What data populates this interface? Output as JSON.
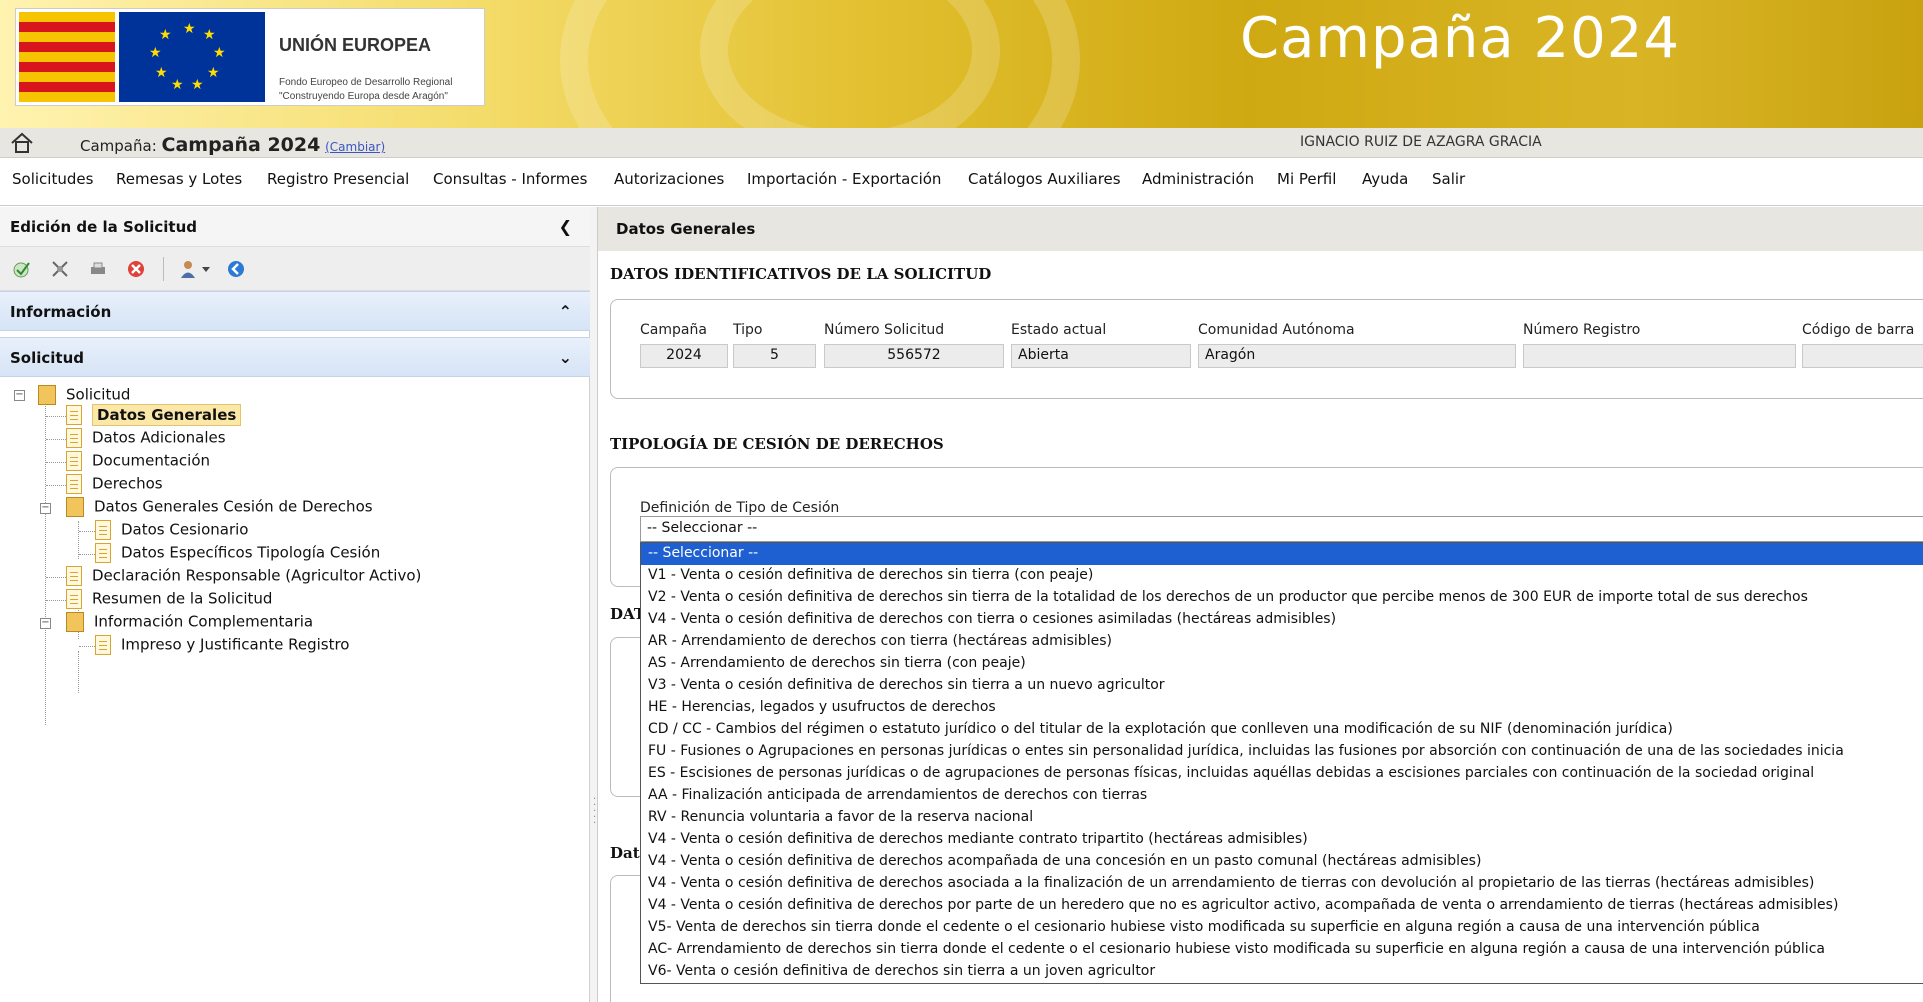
{
  "banner": {
    "eu_title": "UNIÓN EUROPEA",
    "eu_subtitle_1": "Fondo Europeo de Desarrollo Regional",
    "eu_subtitle_2": "\"Construyendo Europa desde Aragón\"",
    "title": "Campaña 2024"
  },
  "campaign_bar": {
    "label": "Campaña: ",
    "value": "Campaña 2024",
    "change_link": "(Cambiar)",
    "user": "IGNACIO RUIZ DE AZAGRA GRACIA"
  },
  "menu": {
    "items": [
      "Solicitudes",
      "Remesas y Lotes",
      "Registro Presencial",
      "Consultas - Informes",
      "Autorizaciones",
      "Importación - Exportación",
      "Catálogos Auxiliares",
      "Administración",
      "Mi Perfil",
      "Ayuda",
      "Salir"
    ]
  },
  "left_panel": {
    "header": "Edición de la Solicitud",
    "info_section": "Información",
    "solicitud_section": "Solicitud",
    "tree": {
      "root": "Solicitud",
      "items": [
        "Datos Generales",
        "Datos Adicionales",
        "Documentación",
        "Derechos",
        "Datos Generales Cesión de Derechos",
        "Datos Cesionario",
        "Datos Específicos Tipología Cesión",
        "Declaración Responsable (Agricultor Activo)",
        "Resumen de la Solicitud",
        "Información Complementaria",
        "Impreso y Justificante Registro"
      ]
    }
  },
  "main": {
    "header": "Datos Generales",
    "ident_title": "DATOS IDENTIFICATIVOS DE LA SOLICITUD",
    "fields": {
      "campaign_label": "Campaña",
      "campaign_value": "2024",
      "type_label": "Tipo",
      "type_value": "5",
      "number_label": "Número Solicitud",
      "number_value": "556572",
      "state_label": "Estado actual",
      "state_value": "Abierta",
      "community_label": "Comunidad Autónoma",
      "community_value": "Aragón",
      "register_label": "Número Registro",
      "register_value": "",
      "barcode_label": "Código de barra"
    },
    "typology_title": "TIPOLOGÍA DE CESIÓN DE DERECHOS",
    "definition_label": "Definición de Tipo de Cesión",
    "select_value": "-- Seleccionar --",
    "partial_label_1": "DAT",
    "partial_label_2": "Dat",
    "options": [
      "-- Seleccionar --",
      "V1 - Venta o cesión definitiva de derechos sin tierra (con peaje)",
      "V2 - Venta o cesión definitiva de derechos sin tierra de la totalidad de los derechos de un productor que percibe menos de 300 EUR de importe total de sus derechos",
      "V4 - Venta o cesión definitiva de derechos con tierra o cesiones asimiladas (hectáreas admisibles)",
      "AR - Arrendamiento de derechos con tierra (hectáreas admisibles)",
      "AS - Arrendamiento de derechos sin tierra (con peaje)",
      "V3 - Venta o cesión definitiva de derechos sin tierra a un nuevo agricultor",
      "HE - Herencias, legados y usufructos de derechos",
      "CD / CC - Cambios del régimen o estatuto jurídico o del titular de la explotación que conlleven una modificación de su NIF (denominación jurídica)",
      "FU - Fusiones o Agrupaciones en personas jurídicas o entes sin personalidad jurídica, incluidas las fusiones por absorción con continuación de una de las sociedades inicia",
      "ES - Escisiones de personas jurídicas o de agrupaciones de personas físicas, incluidas aquéllas debidas a escisiones parciales con continuación de la sociedad original",
      "AA - Finalización anticipada de arrendamientos de derechos con tierras",
      "RV - Renuncia voluntaria a favor de la reserva nacional",
      "V4 - Venta o cesión definitiva de derechos mediante contrato tripartito (hectáreas admisibles)",
      "V4 - Venta o cesión definitiva de derechos acompañada de una concesión en un pasto comunal (hectáreas admisibles)",
      "V4 - Venta o cesión definitiva de derechos asociada a la finalización de un arrendamiento de tierras con devolución al propietario de las tierras (hectáreas admisibles)",
      "V4 - Venta o cesión definitiva de derechos por parte de un heredero que no es agricultor activo, acompañada de venta o arrendamiento de tierras (hectáreas admisibles)",
      "V5- Venta de derechos sin tierra donde el cedente o el cesionario hubiese visto modificada su superficie en alguna región a causa de una intervención pública",
      "AC- Arrendamiento de derechos sin tierra donde el cedente o el cesionario hubiese visto modificada su superficie en alguna región a causa de una intervención pública",
      "V6- Venta o cesión definitiva de derechos sin tierra a un joven agricultor"
    ]
  },
  "colors": {
    "selection": "#1e5fd1",
    "accordion": "#d6e4f6",
    "header_bar": "#e8e6e0"
  }
}
